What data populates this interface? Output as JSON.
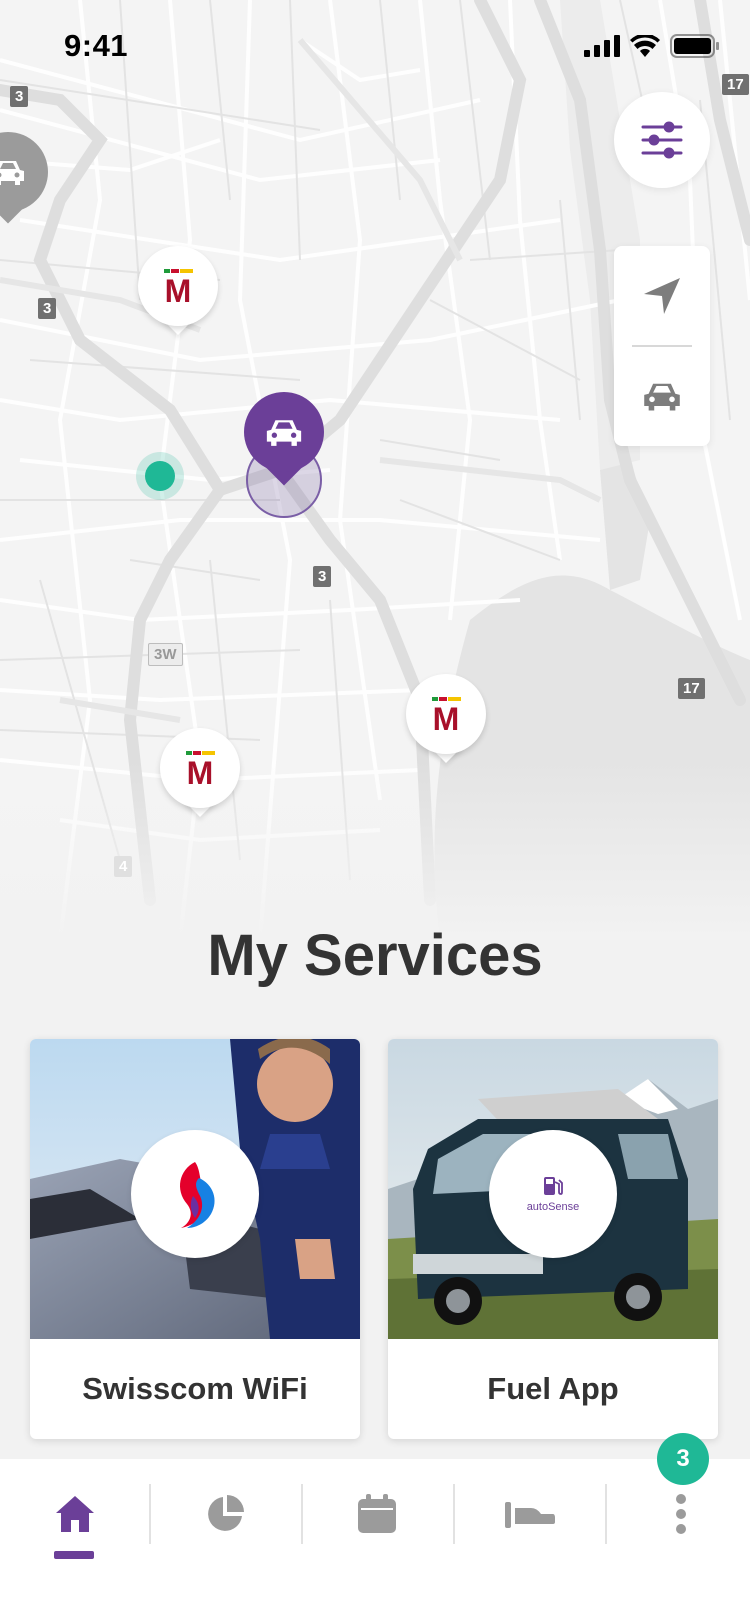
{
  "status_bar": {
    "time": "9:41",
    "icons": [
      "signal-icon",
      "wifi-icon",
      "battery-icon"
    ]
  },
  "map": {
    "road_shields": [
      "3",
      "3",
      "3",
      "3W",
      "17",
      "17",
      "4"
    ],
    "markers": [
      {
        "type": "migrol-station",
        "logo_text": "M"
      },
      {
        "type": "migrol-station",
        "logo_text": "M"
      },
      {
        "type": "migrol-station",
        "logo_text": "M"
      },
      {
        "type": "selected-car",
        "icon": "car-icon"
      },
      {
        "type": "car",
        "icon": "car-icon"
      },
      {
        "type": "user-location"
      }
    ],
    "controls": {
      "filter_icon": "sliders-icon",
      "locate_icon": "navigation-arrow-icon",
      "car_icon": "car-icon"
    }
  },
  "services": {
    "title": "My Services",
    "cards": [
      {
        "label": "Swisscom WiFi",
        "logo": "swisscom-logo"
      },
      {
        "label": "Fuel App",
        "logo": "autosense-logo",
        "logo_text": "autoSense"
      }
    ]
  },
  "tab_bar": {
    "tabs": [
      {
        "name": "home",
        "icon": "home-icon",
        "active": true
      },
      {
        "name": "stats",
        "icon": "pie-chart-icon",
        "active": false
      },
      {
        "name": "calendar",
        "icon": "calendar-icon",
        "active": false
      },
      {
        "name": "trips",
        "icon": "route-icon",
        "active": false
      },
      {
        "name": "more",
        "icon": "more-vertical-icon",
        "active": false
      }
    ],
    "badge_count": "3"
  },
  "colors": {
    "brand_purple": "#6b3f98",
    "accent_teal": "#1fb896",
    "migrol_red": "#a8102a"
  }
}
